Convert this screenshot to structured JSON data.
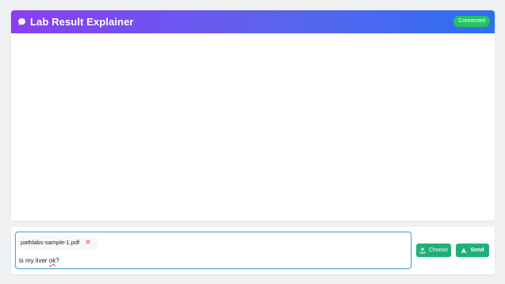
{
  "header": {
    "title": "Lab Result Explainer",
    "logo_icon": "chat-bubble-icon",
    "status": "Connected",
    "gradient_start": "#8b3ff0",
    "gradient_end": "#2f6ff0",
    "status_color": "#22c55e"
  },
  "composer": {
    "attachment": {
      "filename": "pathlabs-sample-1.pdf",
      "remove_icon": "close-icon",
      "remove_symbol": "✕"
    },
    "message_prefix": "is my liver ",
    "message_misspelled": "ok",
    "message_suffix": "?",
    "choose_label": "Choose",
    "choose_icon": "upload-icon",
    "send_label": "Send",
    "send_icon": "send-arrow-icon",
    "button_color": "#1fb07a"
  }
}
